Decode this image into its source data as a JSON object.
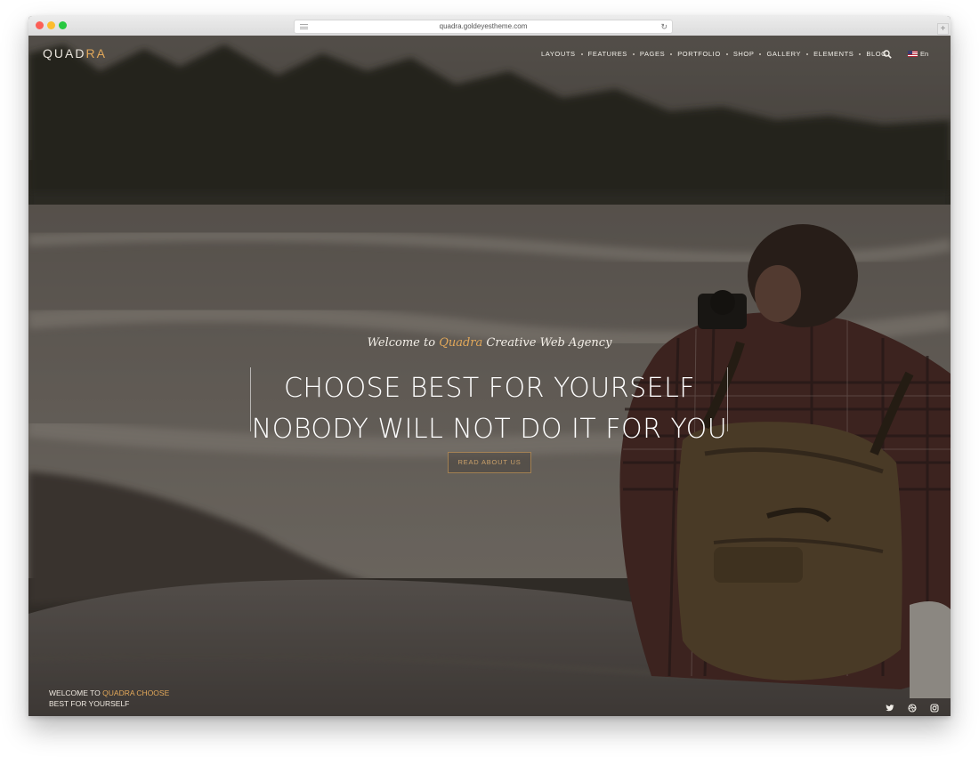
{
  "browser": {
    "url": "quadra.goldeyestheme.com"
  },
  "header": {
    "logo_main": "QUAD",
    "logo_accent": "RA",
    "nav": [
      {
        "label": "LAYOUTS"
      },
      {
        "label": "FEATURES"
      },
      {
        "label": "PAGES"
      },
      {
        "label": "PORTFOLIO"
      },
      {
        "label": "SHOP"
      },
      {
        "label": "GALLERY"
      },
      {
        "label": "ELEMENTS"
      },
      {
        "label": "BLOG"
      }
    ],
    "search_icon": "search-icon",
    "language": "En"
  },
  "hero": {
    "welcome_prefix": "Welcome to",
    "welcome_accent": "Quadra",
    "welcome_suffix": "Creative Web Agency",
    "headline_line1": "CHOOSE BEST FOR YOURSELF",
    "headline_line2": "NOBODY WILL NOT DO IT FOR YOU",
    "button_label": "READ ABOUT US"
  },
  "footer": {
    "tagline_prefix": "WELCOME TO",
    "tagline_accent": "QUADRA CHOOSE",
    "tagline_line2": "BEST FOR YOURSELF",
    "socials": [
      "twitter-icon",
      "dribbble-icon",
      "instagram-icon"
    ]
  },
  "colors": {
    "accent": "#e2a85a",
    "text_light": "#f2efe9"
  }
}
